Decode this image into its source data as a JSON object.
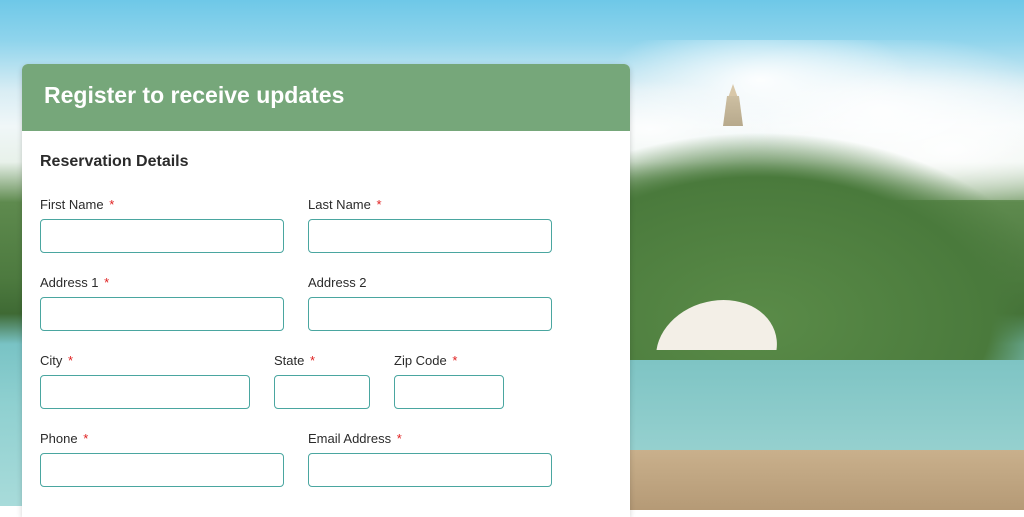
{
  "header": {
    "title": "Register to receive updates"
  },
  "section": {
    "title": "Reservation Details"
  },
  "fields": {
    "first_name": {
      "label": "First Name",
      "required": true,
      "value": ""
    },
    "last_name": {
      "label": "Last Name",
      "required": true,
      "value": ""
    },
    "address1": {
      "label": "Address 1",
      "required": true,
      "value": ""
    },
    "address2": {
      "label": "Address 2",
      "required": false,
      "value": ""
    },
    "city": {
      "label": "City",
      "required": true,
      "value": ""
    },
    "state": {
      "label": "State",
      "required": true,
      "value": ""
    },
    "zip": {
      "label": "Zip Code",
      "required": true,
      "value": ""
    },
    "phone": {
      "label": "Phone",
      "required": true,
      "value": ""
    },
    "email": {
      "label": "Email Address",
      "required": true,
      "value": ""
    }
  },
  "required_marker": "*"
}
